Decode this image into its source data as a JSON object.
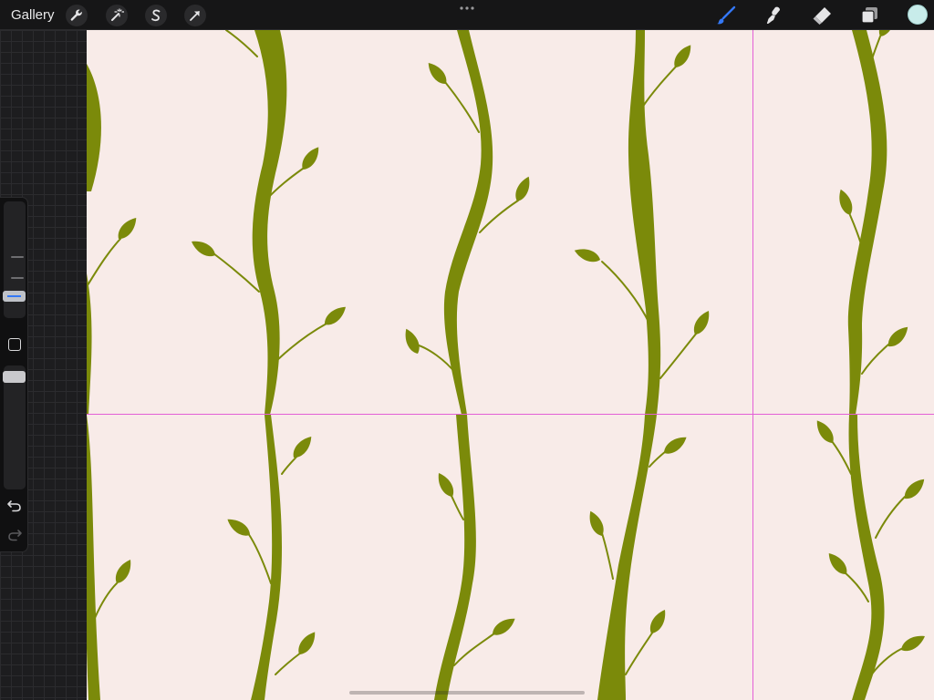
{
  "toolbar": {
    "gallery_label": "Gallery",
    "left_tools": [
      {
        "name": "actions",
        "icon": "wrench-icon"
      },
      {
        "name": "adjustments",
        "icon": "magic-wand-icon"
      },
      {
        "name": "selection",
        "icon": "selection-s-icon"
      },
      {
        "name": "transform",
        "icon": "arrow-cursor-icon"
      }
    ],
    "more_icon": "more-dots-icon",
    "right_tools": [
      {
        "name": "brush",
        "icon": "brush-icon",
        "active": true
      },
      {
        "name": "smudge",
        "icon": "smudge-icon",
        "active": false
      },
      {
        "name": "eraser",
        "icon": "eraser-icon",
        "active": false
      },
      {
        "name": "layers",
        "icon": "layers-icon",
        "active": false
      }
    ],
    "current_color": "#c8ecea",
    "active_color": "#3478f6"
  },
  "sidebar": {
    "size_icon": "brush-size-slider",
    "modify_icon": "square-modify-icon",
    "opacity_icon": "opacity-slider",
    "undo_icon": "undo-icon",
    "redo_icon": "redo-icon"
  },
  "canvas": {
    "background": "#f8ebe8",
    "stem_color": "#7b8a0a",
    "guide_color": "#e35fd6"
  }
}
